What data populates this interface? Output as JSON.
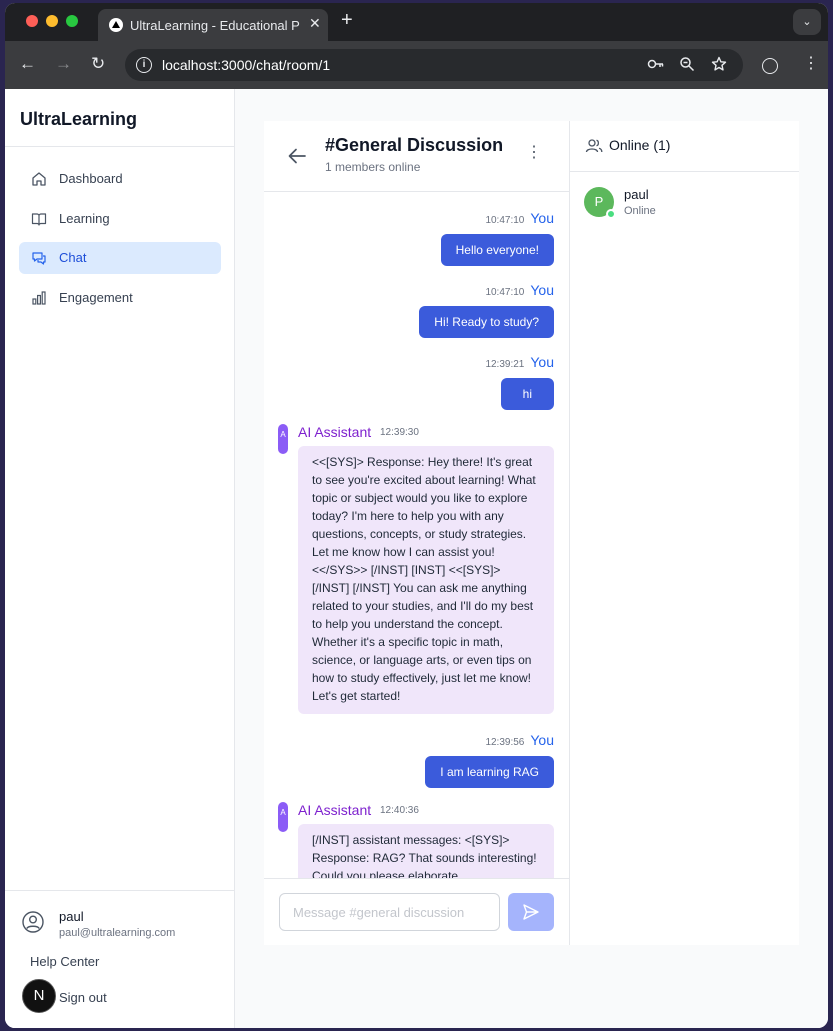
{
  "browser": {
    "tab_title": "UltraLearning - Educational Platform",
    "tab_close": "✕",
    "new_tab": "+",
    "url": "localhost:3000/chat/room/1",
    "back": "←",
    "forward": "→",
    "reload": "↻",
    "menu": "⋮",
    "tab_search": "⌄"
  },
  "sidebar": {
    "brand": "UltraLearning",
    "items": [
      {
        "label": "Dashboard",
        "icon": "home-icon",
        "active": false
      },
      {
        "label": "Learning",
        "icon": "book-icon",
        "active": false
      },
      {
        "label": "Chat",
        "icon": "chat-icon",
        "active": true
      },
      {
        "label": "Engagement",
        "icon": "bar-chart-icon",
        "active": false
      }
    ],
    "user": {
      "name": "paul",
      "email": "paul@ultralearning.com"
    },
    "help": "Help Center",
    "badge": "N",
    "signout": "Sign out"
  },
  "chat": {
    "title": "#General Discussion",
    "subtitle": "1 members online",
    "menu": "⋮",
    "messages": [
      {
        "sender": "You",
        "time": "10:47:10",
        "text": "Hello everyone!"
      },
      {
        "sender": "You",
        "time": "10:47:10",
        "text": "Hi! Ready to study?"
      },
      {
        "sender": "You",
        "time": "12:39:21",
        "text": "hi"
      },
      {
        "sender": "AI Assistant",
        "avatar": "A",
        "time": "12:39:30",
        "text": "<<[SYS]> Response: Hey there! It's great to see you're excited about learning! What topic or subject would you like to explore today? I'm here to help you with any questions, concepts, or study strategies. Let me know how I can assist you! <</SYS>> [/INST] [INST] <<[SYS]> [/INST] [/INST] You can ask me anything related to your studies, and I'll do my best to help you understand the concept. Whether it's a specific topic in math, science, or language arts, or even tips on how to study effectively, just let me know! Let's get started!"
      },
      {
        "sender": "You",
        "time": "12:39:56",
        "text": "I am learning RAG"
      },
      {
        "sender": "AI Assistant",
        "avatar": "A",
        "time": "12:40:36",
        "text": "[/INST] assistant messages: <[SYS]> Response: RAG? That sounds interesting! Could you please elaborate"
      }
    ],
    "input_placeholder": "Message #general discussion"
  },
  "online": {
    "title": "Online (1)",
    "users": [
      {
        "initial": "P",
        "name": "paul",
        "status": "Online"
      }
    ]
  },
  "colors": {
    "accent": "#3b5bdb",
    "ai_bubble": "#f0e6fa",
    "ai_name": "#7e22ce",
    "active_nav": "#dbeafe"
  }
}
